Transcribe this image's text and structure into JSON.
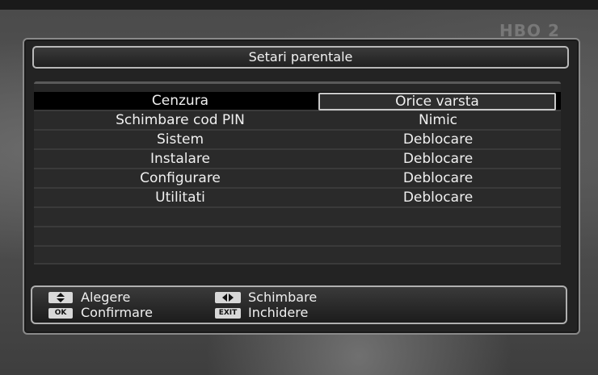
{
  "channel_logo": "HBO 2",
  "dialog": {
    "title": "Setari parentale"
  },
  "rows": [
    {
      "label": "Cenzura",
      "value": "Orice varsta",
      "selected": true
    },
    {
      "label": "Schimbare cod PIN",
      "value": "Nimic",
      "selected": false
    },
    {
      "label": "Sistem",
      "value": "Deblocare",
      "selected": false
    },
    {
      "label": "Instalare",
      "value": "Deblocare",
      "selected": false
    },
    {
      "label": "Configurare",
      "value": "Deblocare",
      "selected": false
    },
    {
      "label": "Utilitati",
      "value": "Deblocare",
      "selected": false
    },
    {
      "label": "",
      "value": "",
      "selected": false
    },
    {
      "label": "",
      "value": "",
      "selected": false
    },
    {
      "label": "",
      "value": "",
      "selected": false
    }
  ],
  "help": {
    "select": {
      "icon": "up-down-arrows-icon",
      "label": "Alegere"
    },
    "change": {
      "icon": "left-right-arrows-icon",
      "label": "Schimbare"
    },
    "confirm": {
      "key": "OK",
      "label": "Confirmare"
    },
    "close": {
      "key": "EXIT",
      "label": "Inchidere"
    }
  },
  "colors": {
    "selected_row": "#000000",
    "text": "#f0f0f0",
    "panel": "#232323"
  }
}
